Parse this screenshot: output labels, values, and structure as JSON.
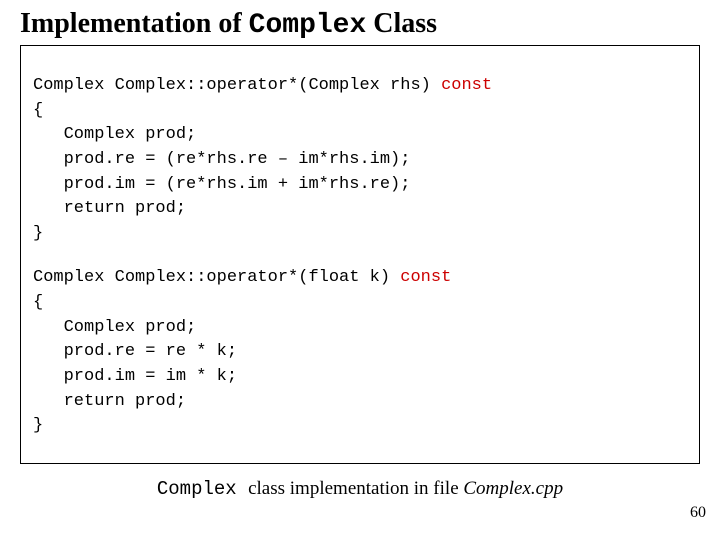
{
  "title": {
    "prefix": "Implementation of ",
    "mono": "Complex",
    "suffix": " Class"
  },
  "code1": {
    "l0a": "Complex Complex::operator*(Complex rhs) ",
    "l0b": "const",
    "l1": "{",
    "l2": "   Complex prod;",
    "l3": "   prod.re = (re*rhs.re – im*rhs.im);",
    "l4": "   prod.im = (re*rhs.im + im*rhs.re);",
    "l5": "   return prod;",
    "l6": "}"
  },
  "code2": {
    "l0a": "Complex Complex::operator*(float k) ",
    "l0b": "const",
    "l1": "{",
    "l2": "   Complex prod;",
    "l3": "   prod.re = re * k;",
    "l4": "   prod.im = im * k;",
    "l5": "   return prod;",
    "l6": "}"
  },
  "caption": {
    "mono": "Complex ",
    "mid": "class implementation in file ",
    "fname": "Complex.cpp"
  },
  "pagenum": "60"
}
